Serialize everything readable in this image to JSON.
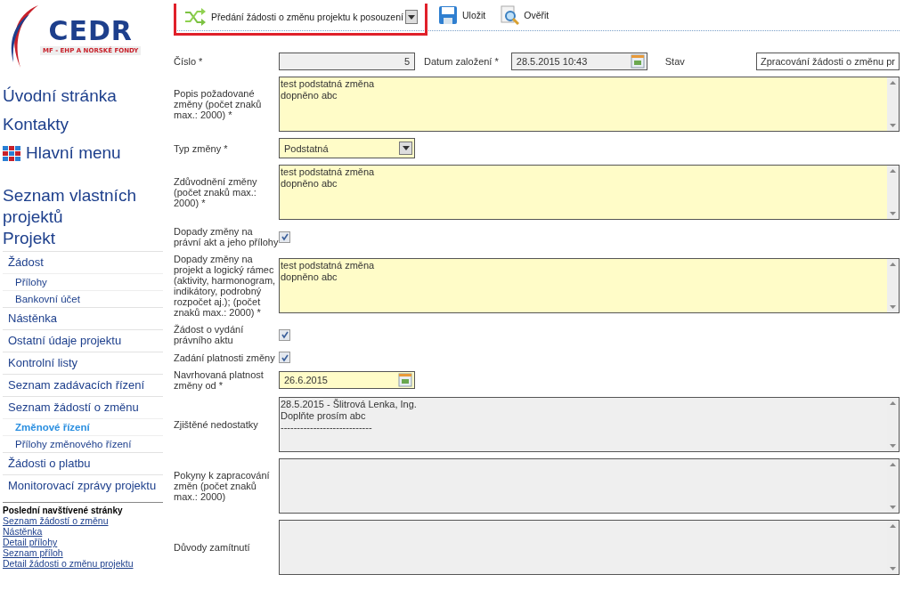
{
  "logo": {
    "name": "CEDR",
    "subtitle": "MF - EHP A NORSKÉ FONDY"
  },
  "top_links": [
    {
      "label": "Úvodní stránka",
      "kind": "link"
    },
    {
      "label": "Kontakty",
      "kind": "link"
    },
    {
      "label": "Hlavní menu",
      "kind": "menu"
    }
  ],
  "project_links": [
    "Seznam vlastních projektů",
    "Projekt"
  ],
  "nav": [
    {
      "label": "Žádost",
      "selected": false,
      "children": [
        {
          "label": "Přílohy",
          "selected": false
        },
        {
          "label": "Bankovní účet",
          "selected": false
        }
      ]
    },
    {
      "label": "Nástěnka",
      "selected": false
    },
    {
      "label": "Ostatní údaje projektu",
      "selected": false
    },
    {
      "label": "Kontrolní listy",
      "selected": false
    },
    {
      "label": "Seznam zadávacích řízení",
      "selected": false
    },
    {
      "label": "Seznam žádostí o změnu",
      "selected": false,
      "children": [
        {
          "label": "Změnové řízení",
          "selected": true
        },
        {
          "label": "Přílohy změnového řízení",
          "selected": false
        }
      ]
    },
    {
      "label": "Žádosti o platbu",
      "selected": false
    },
    {
      "label": "Monitorovací zprávy projektu",
      "selected": false
    }
  ],
  "recent": {
    "title": "Poslední navštívené stránky",
    "links": [
      "Seznam žádostí o změnu",
      "Nástěnka",
      "Detail přílohy",
      "Seznam příloh",
      "Detail žádosti o změnu projektu"
    ]
  },
  "toolbar": [
    {
      "label": "Předání žádosti o změnu projektu k posouzení",
      "kind": "workflow",
      "highlighted": true
    },
    {
      "label": "Uložit",
      "kind": "save",
      "highlighted": false
    },
    {
      "label": "Ověřit",
      "kind": "verify",
      "highlighted": false
    }
  ],
  "header_row": {
    "number_label": "Číslo *",
    "number": "5",
    "date_label": "Datum založení *",
    "date": "28.5.2015 10:43",
    "status_label": "Stav",
    "status": "Zpracování žádosti o změnu pr"
  },
  "rows": [
    {
      "kind": "textarea",
      "label": "Popis požadované změny (počet znaků max.: 2000) *",
      "value": "test podstatná změna\ndopněno abc",
      "disabled": false
    },
    {
      "kind": "select",
      "label": "Typ změny *",
      "value": "Podstatná"
    },
    {
      "kind": "textarea",
      "label": "Zdůvodnění změny (počet znaků max.: 2000) *",
      "value": "test podstatná změna\ndopněno abc",
      "disabled": false
    },
    {
      "kind": "checkbox",
      "label": "Dopady změny na právní akt a jeho přílohy",
      "checked": true
    },
    {
      "kind": "textarea",
      "label": "Dopady změny na projekt a logický rámec (aktivity, harmonogram, indikátory, podrobný rozpočet aj.); (počet znaků max.: 2000) *",
      "value": "test podstatná změna\ndopněno abc",
      "disabled": false
    },
    {
      "kind": "checkbox",
      "label": "Žádost o vydání právního aktu",
      "checked": true
    },
    {
      "kind": "checkbox",
      "label": "Zadání platnosti změny",
      "checked": true
    },
    {
      "kind": "date",
      "label": "Navrhovaná platnost změny od *",
      "value": "26.6.2015"
    },
    {
      "kind": "textarea",
      "label": "Zjištěné nedostatky",
      "value": "28.5.2015 - Šlitrová Lenka, Ing.\nDoplňte prosím abc\n----------------------------",
      "disabled": true
    },
    {
      "kind": "textarea",
      "label": "Pokyny k zapracování změn (počet znaků max.: 2000)",
      "disabled": true
    },
    {
      "kind": "textarea",
      "label": "Důvody zamítnutí",
      "disabled": true
    }
  ]
}
